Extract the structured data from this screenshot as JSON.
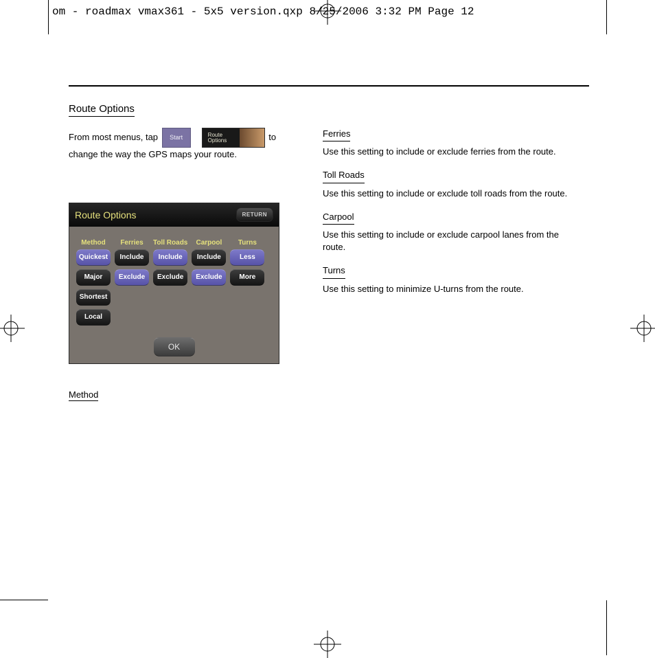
{
  "print_header": "om - roadmax vmax361 - 5x5 version.qxp  8/25/2006  3:32 PM  Page 12",
  "section_title": "Route Options",
  "intro_prefix": "From most menus, tap",
  "intro_suffix": "to change the way the GPS maps your route.",
  "btn_start_label": "Start",
  "btn_routeopts_line1": "Route",
  "btn_routeopts_line2": "Options",
  "device": {
    "title": "Route Options",
    "return": "RETURN",
    "ok": "OK",
    "cols": [
      {
        "label": "Method",
        "items": [
          {
            "t": "Quickest",
            "sel": true
          },
          {
            "t": "Major",
            "sel": false
          },
          {
            "t": "Shortest",
            "sel": false
          },
          {
            "t": "Local",
            "sel": false
          }
        ]
      },
      {
        "label": "Ferries",
        "items": [
          {
            "t": "Include",
            "sel": false
          },
          {
            "t": "Exclude",
            "sel": true
          }
        ]
      },
      {
        "label": "Toll Roads",
        "items": [
          {
            "t": "Include",
            "sel": true
          },
          {
            "t": "Exclude",
            "sel": false
          }
        ]
      },
      {
        "label": "Carpool",
        "items": [
          {
            "t": "Include",
            "sel": false
          },
          {
            "t": "Exclude",
            "sel": true
          }
        ]
      },
      {
        "label": "Turns",
        "items": [
          {
            "t": "Less",
            "sel": true
          },
          {
            "t": "More",
            "sel": false
          }
        ]
      }
    ]
  },
  "left_subhead": "Method",
  "right": [
    {
      "h": "Ferries",
      "t": "Use this setting to include or exclude ferries from the route."
    },
    {
      "h": "Toll Roads",
      "t": "Use this setting to include or exclude toll roads from the route."
    },
    {
      "h": "Carpool",
      "t": "Use this setting to include or exclude carpool lanes from the route."
    },
    {
      "h": "Turns",
      "t": "Use this setting to minimize U-turns from the route."
    }
  ]
}
